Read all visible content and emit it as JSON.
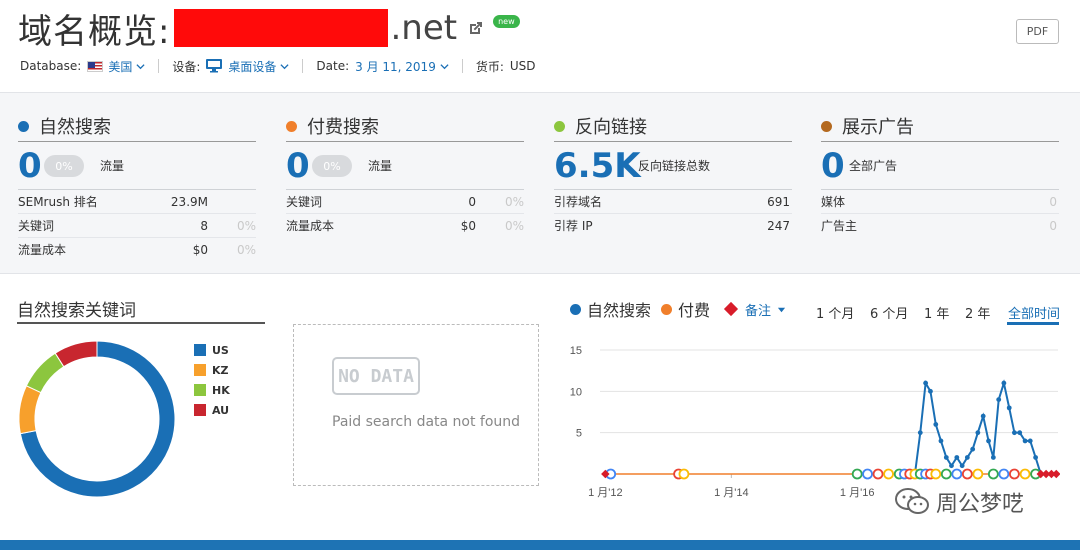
{
  "header": {
    "title": "域名概览:",
    "domain_suffix": ".net",
    "new_badge": "new",
    "pdf_label": "PDF"
  },
  "filters": {
    "database_label": "Database:",
    "database_value": "美国",
    "device_label": "设备:",
    "device_value": "桌面设备",
    "date_label": "Date:",
    "date_value": "3 月 11, 2019",
    "currency_label": "货币:",
    "currency_value": "USD"
  },
  "metrics": {
    "organic": {
      "title": "自然搜索",
      "color": "#1a6fb5",
      "value": "0",
      "pct": "0%",
      "caption": "流量",
      "rows": [
        {
          "label": "SEMrush 排名",
          "value": "23.9M",
          "pct": ""
        },
        {
          "label": "关键词",
          "value": "8",
          "pct": "0%"
        },
        {
          "label": "流量成本",
          "value": "$0",
          "pct": "0%"
        }
      ]
    },
    "paid": {
      "title": "付费搜索",
      "color": "#f07f2b",
      "value": "0",
      "pct": "0%",
      "caption": "流量",
      "rows": [
        {
          "label": "关键词",
          "value": "0",
          "pct": "0%"
        },
        {
          "label": "流量成本",
          "value": "$0",
          "pct": "0%"
        }
      ]
    },
    "backlinks": {
      "title": "反向链接",
      "color": "#8cc63e",
      "value": "6.5K",
      "caption": "反向链接总数",
      "rows": [
        {
          "label": "引荐域名",
          "value": "691"
        },
        {
          "label": "引荐 IP",
          "value": "247"
        }
      ]
    },
    "display": {
      "title": "展示广告",
      "color": "#b4691f",
      "value": "0",
      "caption": "全部广告",
      "rows": [
        {
          "label": "媒体",
          "value": "0"
        },
        {
          "label": "广告主",
          "value": "0"
        }
      ]
    }
  },
  "organic_keywords": {
    "title": "自然搜索关键词",
    "donut": [
      {
        "label": "US",
        "value": 72,
        "color": "#1a6fb5"
      },
      {
        "label": "KZ",
        "value": 10,
        "color": "#f7a02c"
      },
      {
        "label": "HK",
        "value": 9,
        "color": "#8cc63e"
      },
      {
        "label": "AU",
        "value": 9,
        "color": "#c8262f"
      }
    ]
  },
  "paid_panel": {
    "badge": "NO DATA",
    "message": "Paid search data not found"
  },
  "trend": {
    "legend_organic": "自然搜索",
    "legend_paid": "付费",
    "notes_label": "备注",
    "ranges": [
      "1 个月",
      "6 个月",
      "1 年",
      "2 年",
      "全部时间"
    ],
    "active_range": "全部时间",
    "x_labels": [
      "1 月'12",
      "1 月'14",
      "1 月'16"
    ],
    "y_ticks": [
      15,
      10,
      5
    ]
  },
  "chart_data": {
    "type": "line",
    "title": "",
    "xlabel": "",
    "ylabel": "",
    "ylim": [
      0,
      15
    ],
    "grid": true,
    "series": [
      {
        "name": "自然搜索",
        "color": "#1a6fb5",
        "x": [
          "2016-12",
          "2017-01",
          "2017-02",
          "2017-03",
          "2017-04",
          "2017-05",
          "2017-06",
          "2017-07",
          "2017-08",
          "2017-09",
          "2017-10",
          "2017-11",
          "2017-12",
          "2018-01",
          "2018-02",
          "2018-03",
          "2018-04",
          "2018-05",
          "2018-06",
          "2018-07",
          "2018-08",
          "2018-09",
          "2018-10",
          "2018-11",
          "2018-12"
        ],
        "values": [
          0,
          5,
          11,
          10,
          6,
          4,
          2,
          1,
          2,
          1,
          2,
          3,
          5,
          7,
          4,
          2,
          9,
          11,
          8,
          5,
          5,
          4,
          4,
          2,
          0
        ]
      },
      {
        "name": "付费",
        "color": "#f07f2b",
        "x": [
          "2012-01",
          "2019-03"
        ],
        "values": [
          0,
          0
        ]
      }
    ]
  },
  "watermark": "周公梦呓"
}
